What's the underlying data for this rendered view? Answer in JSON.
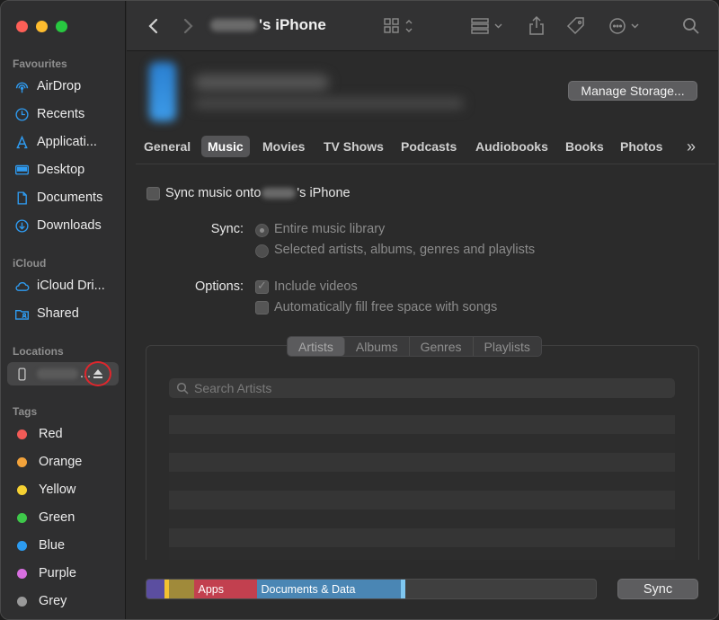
{
  "window": {
    "title_suffix": "'s iPhone"
  },
  "sidebar": {
    "favourites_title": "Favourites",
    "favourites": [
      {
        "label": "AirDrop",
        "icon": "airdrop-icon"
      },
      {
        "label": "Recents",
        "icon": "clock-icon"
      },
      {
        "label": "Applicati...",
        "icon": "applications-icon"
      },
      {
        "label": "Desktop",
        "icon": "desktop-icon"
      },
      {
        "label": "Documents",
        "icon": "document-icon"
      },
      {
        "label": "Downloads",
        "icon": "download-icon"
      }
    ],
    "icloud_title": "iCloud",
    "icloud": [
      {
        "label": "iCloud Dri...",
        "icon": "cloud-icon"
      },
      {
        "label": "Shared",
        "icon": "shared-folder-icon"
      }
    ],
    "locations_title": "Locations",
    "location_device_suffix": "...",
    "tags_title": "Tags",
    "tags": [
      {
        "label": "Red",
        "color": "#f25b57"
      },
      {
        "label": "Orange",
        "color": "#f3a33b"
      },
      {
        "label": "Yellow",
        "color": "#f6d132"
      },
      {
        "label": "Green",
        "color": "#3ec84a"
      },
      {
        "label": "Blue",
        "color": "#2c9bf0"
      },
      {
        "label": "Purple",
        "color": "#d86fe0"
      },
      {
        "label": "Grey",
        "color": "#9a9a9a"
      }
    ]
  },
  "header": {
    "manage_storage": "Manage Storage..."
  },
  "tabs": [
    "General",
    "Music",
    "Movies",
    "TV Shows",
    "Podcasts",
    "Audiobooks",
    "Books",
    "Photos"
  ],
  "active_tab": "Music",
  "tabs_overflow": "»",
  "music": {
    "sync_prefix": "Sync music onto",
    "sync_suffix": "'s iPhone",
    "sync_label": "Sync:",
    "sync_option_1": "Entire music library",
    "sync_option_2": "Selected artists, albums, genres and playlists",
    "options_label": "Options:",
    "option_include_videos": "Include videos",
    "option_autofill": "Automatically fill free space with songs",
    "segments": [
      "Artists",
      "Albums",
      "Genres",
      "Playlists"
    ],
    "active_segment": "Artists",
    "search_placeholder": "Search Artists"
  },
  "storage_bar": {
    "segments": [
      {
        "label": "",
        "color": "#5b4ea0",
        "share": 0.04
      },
      {
        "label": "",
        "color": "#f3c230",
        "share": 0.006
      },
      {
        "label": "",
        "color": "#a08a3a",
        "share": 0.055
      },
      {
        "label": "Apps",
        "color": "#c2404f",
        "share": 0.14
      },
      {
        "label": "Documents & Data",
        "color": "#4a86b4",
        "share": 0.32
      },
      {
        "label": "",
        "color": "#7fc7f0",
        "share": 0.008
      }
    ]
  },
  "sync_button": "Sync"
}
